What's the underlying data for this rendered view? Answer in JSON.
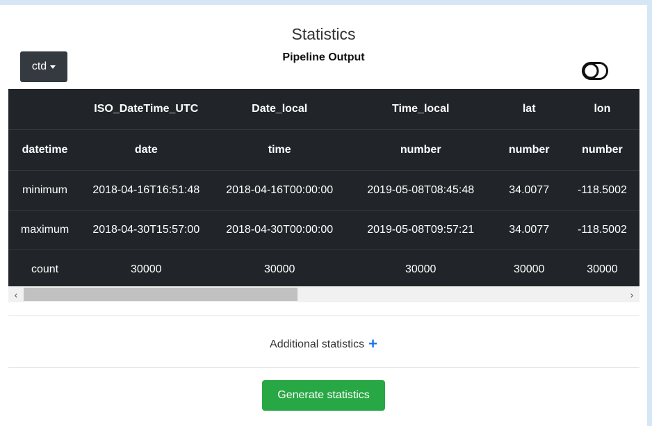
{
  "header": {
    "title": "Statistics",
    "subtitle": "Pipeline Output",
    "dropdown_label": "ctd"
  },
  "table": {
    "columns": [
      "",
      "ISO_DateTime_UTC",
      "Date_local",
      "Time_local",
      "lat",
      "lon"
    ],
    "types": [
      "datetime",
      "date",
      "time",
      "number",
      "number",
      "number"
    ],
    "rows": [
      [
        "minimum",
        "2018-04-16T16:51:48",
        "2018-04-16T00:00:00",
        "2019-05-08T08:45:48",
        "34.0077",
        "-118.5002"
      ],
      [
        "maximum",
        "2018-04-30T15:57:00",
        "2018-04-30T00:00:00",
        "2019-05-08T09:57:21",
        "34.0077",
        "-118.5002"
      ],
      [
        "count",
        "30000",
        "30000",
        "30000",
        "30000",
        "30000"
      ]
    ]
  },
  "scrollbar": {
    "left_arrow": "‹",
    "right_arrow": "›"
  },
  "additional": {
    "label": "Additional statistics",
    "plus": "+"
  },
  "generate_button": "Generate statistics",
  "colors": {
    "table_bg": "#212529",
    "button_green": "#28a745",
    "plus_blue": "#1e73e8",
    "dropdown_bg": "#343a40"
  }
}
